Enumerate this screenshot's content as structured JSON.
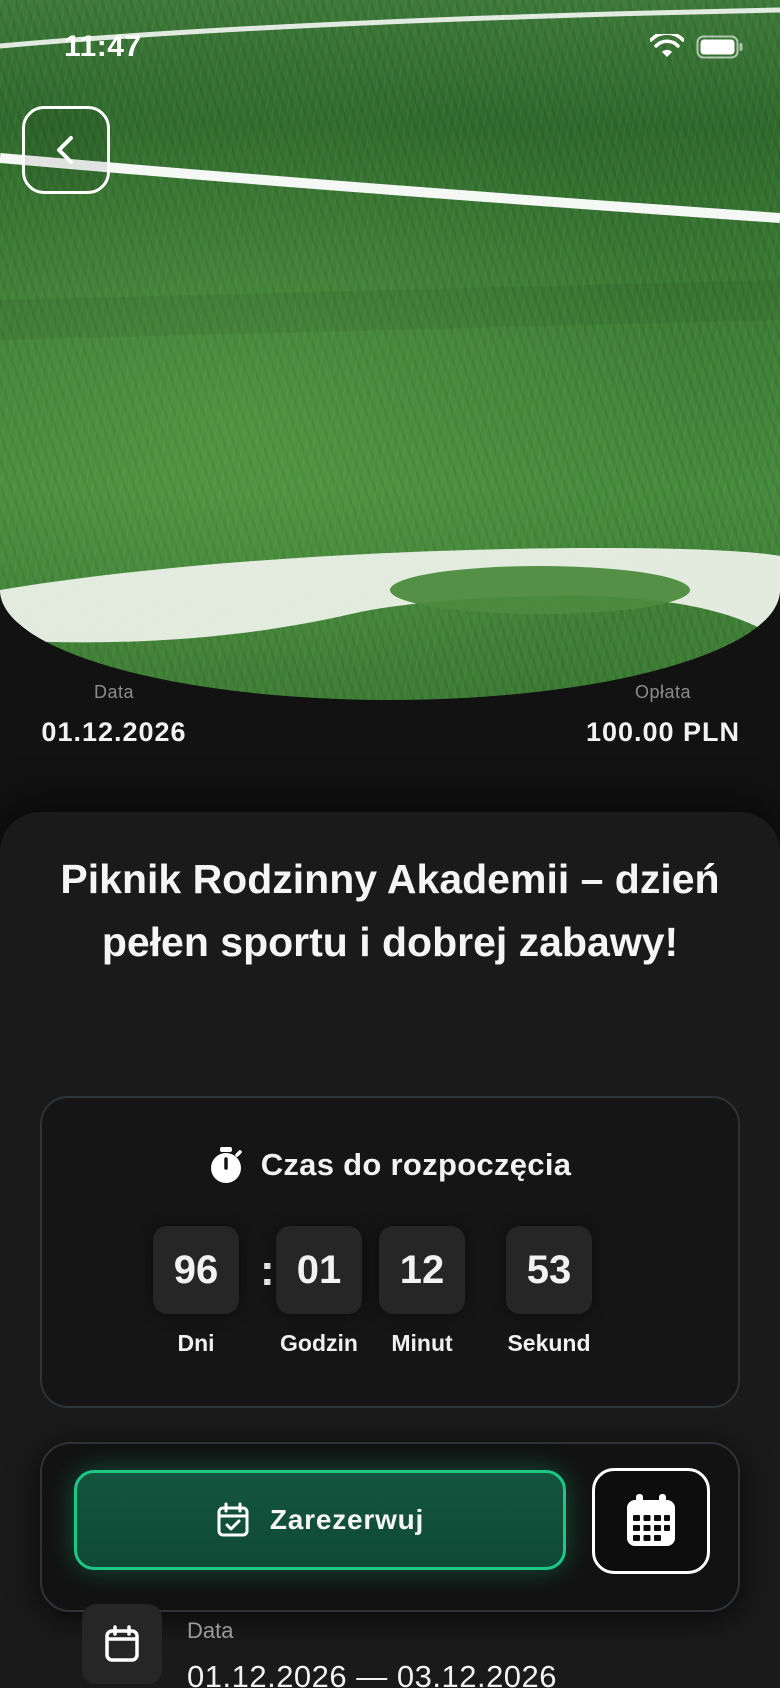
{
  "status_bar": {
    "time": "11:47",
    "icons": [
      "wifi-icon",
      "battery-icon"
    ]
  },
  "header": {
    "back_icon": "chevron-left-icon"
  },
  "meta": {
    "date_label": "Data",
    "date_value": "01.12.2026",
    "fee_label": "Opłata",
    "fee_value": "100.00 PLN"
  },
  "event": {
    "title": "Piknik Rodzinny Akademii – dzień pełen sportu i dobrej zabawy!"
  },
  "countdown": {
    "icon": "stopwatch-icon",
    "title": "Czas do rozpoczęcia",
    "separator": ":",
    "units": [
      {
        "value": "96",
        "label": "Dni"
      },
      {
        "value": "01",
        "label": "Godzin"
      },
      {
        "value": "12",
        "label": "Minut"
      },
      {
        "value": "53",
        "label": "Sekund"
      }
    ]
  },
  "actions": {
    "reserve_label": "Zarezerwuj",
    "reserve_icon": "calendar-check-icon",
    "calendar_icon": "calendar-grid-icon"
  },
  "details": {
    "date_label": "Data",
    "date_range": "01.12.2026 — 03.12.2026",
    "date_icon": "calendar-icon"
  },
  "colors": {
    "accent": "#1ec785",
    "accent_bg": "#14553f",
    "background": "#121212",
    "card": "#1a1a1a"
  }
}
